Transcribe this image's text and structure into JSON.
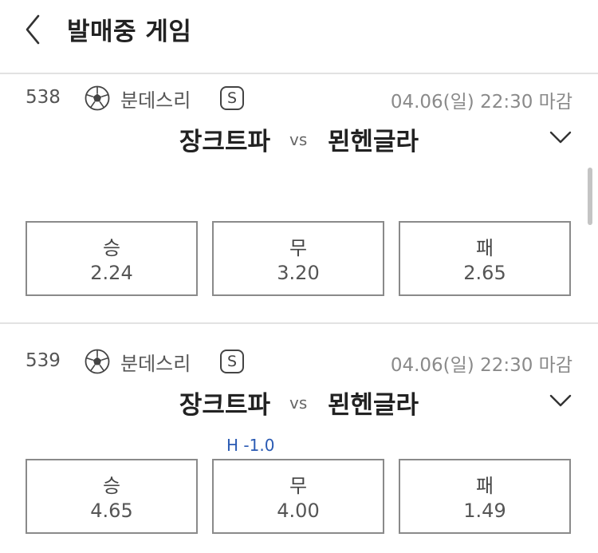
{
  "header": {
    "title": "발매중 게임"
  },
  "games": [
    {
      "number": "538",
      "league": "분데스리",
      "badge": "S",
      "deadline": "04.06(일) 22:30 마감",
      "home": "장크트파",
      "vs": "vs",
      "away": "묀헨글라",
      "handicap": "",
      "odds": [
        {
          "label": "승",
          "value": "2.24"
        },
        {
          "label": "무",
          "value": "3.20"
        },
        {
          "label": "패",
          "value": "2.65"
        }
      ]
    },
    {
      "number": "539",
      "league": "분데스리",
      "badge": "S",
      "deadline": "04.06(일) 22:30 마감",
      "home": "장크트파",
      "vs": "vs",
      "away": "묀헨글라",
      "handicap": "H -1.0",
      "odds": [
        {
          "label": "승",
          "value": "4.65"
        },
        {
          "label": "무",
          "value": "4.00"
        },
        {
          "label": "패",
          "value": "1.49"
        }
      ]
    }
  ]
}
